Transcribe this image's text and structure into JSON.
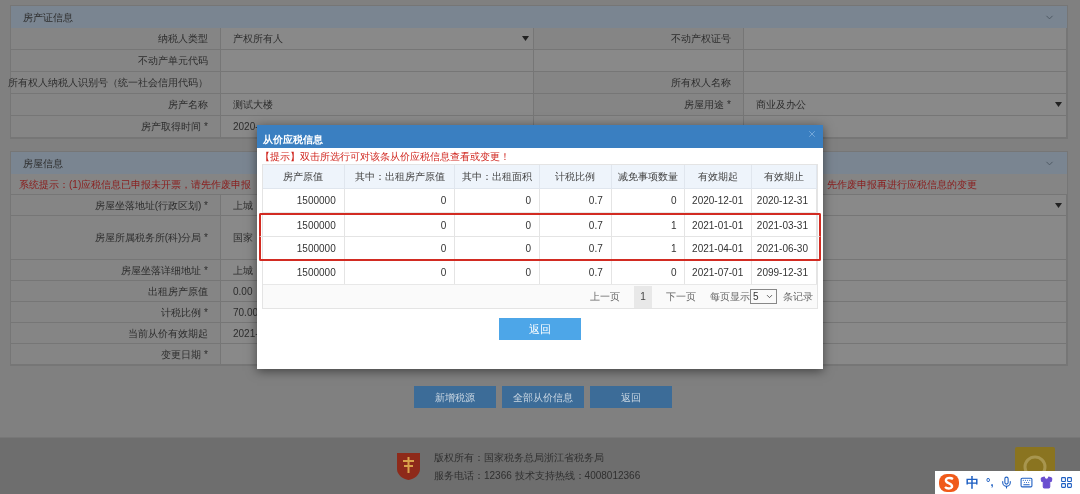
{
  "cert_panel": {
    "title": "房产证信息",
    "rows": [
      {
        "cells": [
          {
            "kind": "label",
            "text": "纳税人类型"
          },
          {
            "kind": "select",
            "text": "产权所有人"
          },
          {
            "kind": "label",
            "text": "不动产权证号"
          },
          {
            "kind": "empty"
          }
        ]
      },
      {
        "cells": [
          {
            "kind": "label",
            "text": "不动产单元代码"
          },
          {
            "kind": "empty"
          },
          {
            "kind": "empty"
          },
          {
            "kind": "empty"
          }
        ]
      },
      {
        "cells": [
          {
            "kind": "label",
            "text": "所有权人纳税人识别号（统一社会信用代码）"
          },
          {
            "kind": "empty"
          },
          {
            "kind": "label",
            "text": "所有权人名称"
          },
          {
            "kind": "empty"
          }
        ]
      },
      {
        "cells": [
          {
            "kind": "label",
            "text": "房产名称"
          },
          {
            "kind": "value",
            "text": "测试大楼"
          },
          {
            "kind": "label",
            "text": "房屋用途 *"
          },
          {
            "kind": "select",
            "text": "商业及办公"
          }
        ]
      },
      {
        "cells": [
          {
            "kind": "label",
            "text": "房产取得时间 *"
          },
          {
            "kind": "value",
            "text": "2020-"
          },
          {
            "kind": "empty"
          },
          {
            "kind": "empty"
          }
        ]
      }
    ]
  },
  "house_panel": {
    "title": "房屋信息",
    "notice": [
      "系统提示：(1)应税信息已申报未开票，请先作废申报",
      "先作废申报再进行应税信息的变更"
    ],
    "rows": [
      {
        "cells": [
          {
            "kind": "label",
            "text": "房屋坐落地址(行政区划) *"
          },
          {
            "kind": "select",
            "text": "上城"
          }
        ]
      },
      {
        "tall": true,
        "cells": [
          {
            "kind": "label",
            "text": "房屋所属税务所(科)分局 *"
          },
          {
            "kind": "value",
            "text": "国家"
          }
        ]
      },
      {
        "cells": [
          {
            "kind": "label",
            "text": "房屋坐落详细地址 *"
          },
          {
            "kind": "value",
            "text": "上城"
          }
        ]
      },
      {
        "cells": [
          {
            "kind": "label",
            "text": "出租房产原值"
          },
          {
            "kind": "value",
            "text": "0.00"
          }
        ]
      },
      {
        "cells": [
          {
            "kind": "label",
            "text": "计税比例 *"
          },
          {
            "kind": "value",
            "text": "70.00"
          }
        ]
      },
      {
        "cells": [
          {
            "kind": "label",
            "text": "当前从价有效期起"
          },
          {
            "kind": "value",
            "text": "2021-"
          }
        ]
      },
      {
        "cells": [
          {
            "kind": "label",
            "text": "变更日期 *"
          },
          {
            "kind": "empty"
          }
        ]
      }
    ]
  },
  "buttons": [
    "新增税源",
    "全部从价信息",
    "返回"
  ],
  "footer": {
    "lines": [
      "版权所有：国家税务总局浙江省税务局",
      "服务电话：12366 技术支持热线：4008012366"
    ]
  },
  "ime": {
    "mode": "中",
    "punct": "°,"
  },
  "dialog": {
    "title": "从价应税信息",
    "hint": "【提示】双击所选行可对该条从价应税信息查看或变更！",
    "columns": [
      "房产原值",
      "其中：出租房产原值",
      "其中：出租面积",
      "计税比例",
      "减免事项数量",
      "有效期起",
      "有效期止"
    ],
    "rows": [
      {
        "marked": false,
        "cells": [
          "1500000",
          "0",
          "0",
          "0.7",
          "0",
          "2020-12-01",
          "2020-12-31"
        ]
      },
      {
        "marked": true,
        "cells": [
          "1500000",
          "0",
          "0",
          "0.7",
          "1",
          "2021-01-01",
          "2021-03-31"
        ]
      },
      {
        "marked": true,
        "cells": [
          "1500000",
          "0",
          "0",
          "0.7",
          "1",
          "2021-04-01",
          "2021-06-30"
        ]
      },
      {
        "marked": false,
        "cells": [
          "1500000",
          "0",
          "0",
          "0.7",
          "0",
          "2021-07-01",
          "2099-12-31"
        ]
      }
    ],
    "pager": {
      "prev": "上一页",
      "page": "1",
      "next": "下一页",
      "per_page_label": "每页显示",
      "per_page": "5",
      "suffix": "条记录"
    },
    "button": "返回"
  }
}
